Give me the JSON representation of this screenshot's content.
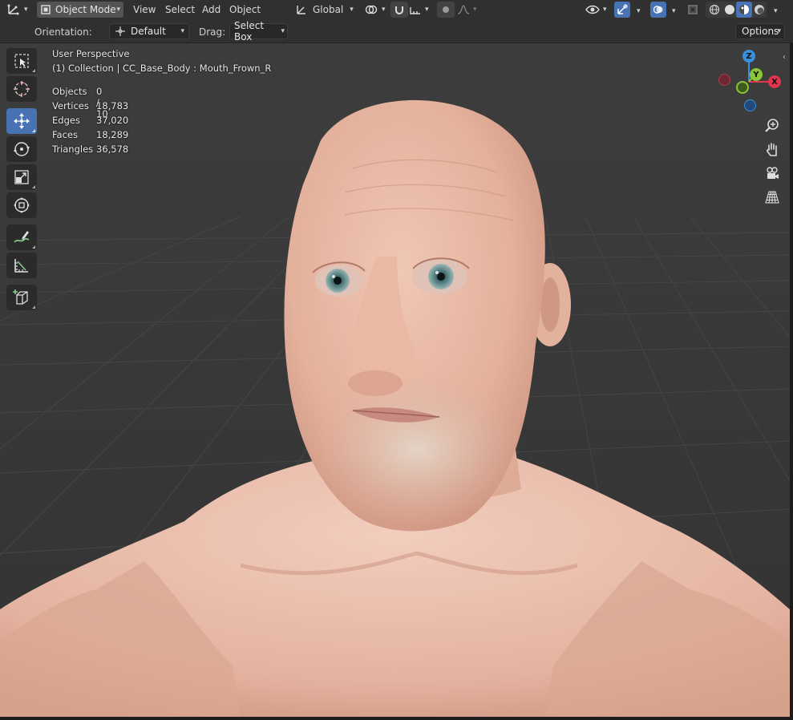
{
  "header": {
    "editor_type_icon": "grid-axes-icon",
    "mode": "Object Mode",
    "menus": [
      "View",
      "Select",
      "Add",
      "Object"
    ],
    "transform_orientation": "Global",
    "shading_modes": [
      "wireframe",
      "solid",
      "material-preview",
      "rendered"
    ],
    "active_shading": "material-preview"
  },
  "tool_settings": {
    "orientation_label": "Orientation:",
    "orientation_value": "Default",
    "drag_label": "Drag:",
    "drag_value": "Select Box",
    "options_label": "Options"
  },
  "toolbar": [
    {
      "name": "select-box",
      "icon": "select-box-icon",
      "active": false
    },
    {
      "name": "cursor",
      "icon": "cursor-icon",
      "active": false
    },
    {
      "name": "move",
      "icon": "move-icon",
      "active": true
    },
    {
      "name": "rotate",
      "icon": "rotate-icon",
      "active": false
    },
    {
      "name": "scale",
      "icon": "scale-icon",
      "active": false
    },
    {
      "name": "transform",
      "icon": "transform-icon",
      "active": false
    },
    {
      "name": "annotate",
      "icon": "annotate-icon",
      "active": false
    },
    {
      "name": "measure",
      "icon": "measure-icon",
      "active": false
    },
    {
      "name": "add-cube",
      "icon": "add-cube-icon",
      "active": false
    }
  ],
  "viewport": {
    "view_name": "User Perspective",
    "collection_path": "(1) Collection | CC_Base_Body : Mouth_Frown_R",
    "stats": {
      "objects_label": "Objects",
      "objects_value": "0 / 10",
      "vertices_label": "Vertices",
      "vertices_value": "18,783",
      "edges_label": "Edges",
      "edges_value": "37,020",
      "faces_label": "Faces",
      "faces_value": "18,289",
      "triangles_label": "Triangles",
      "triangles_value": "36,578"
    }
  },
  "navigation_gizmo": {
    "z_label": "Z",
    "y_label": "Y",
    "x_label": "X",
    "x_color": "#e0364f",
    "y_color": "#8bc638",
    "z_color": "#3a8fdd"
  },
  "nav_buttons": [
    "zoom-icon",
    "hand-pan-icon",
    "camera-icon",
    "grid-ortho-icon"
  ],
  "colors": {
    "accent": "#4772b3",
    "header_bg": "#303030",
    "viewport_bg": "#3b3b3b"
  }
}
